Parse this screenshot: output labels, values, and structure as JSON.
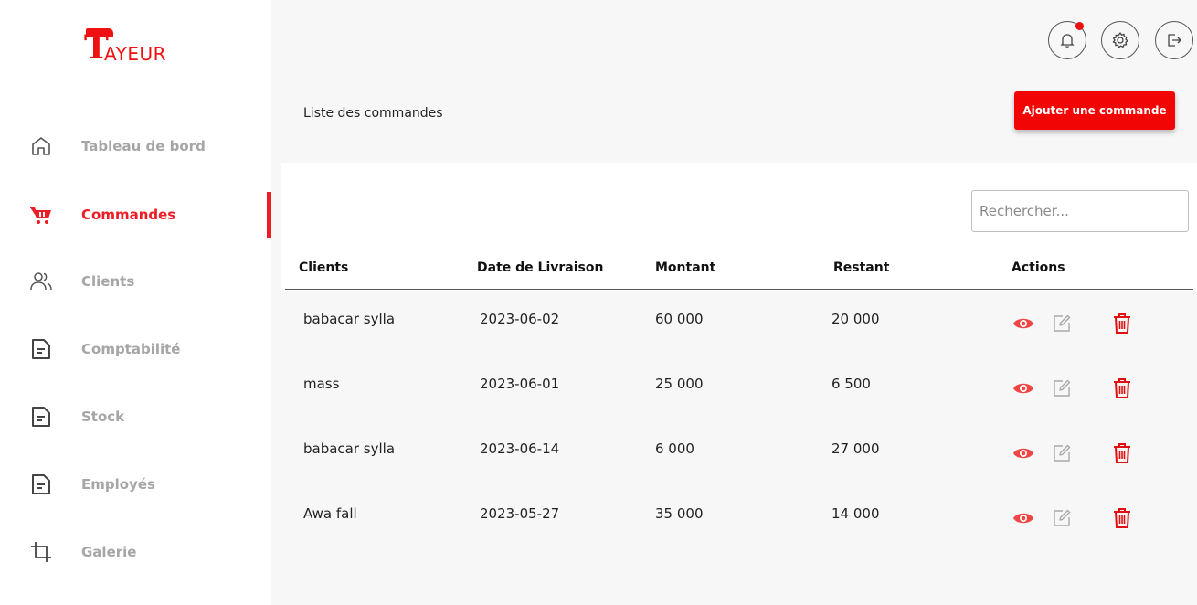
{
  "brand": {
    "logo_initial": "T",
    "logo_rest": "AYEUR",
    "accent": "#ee1c24"
  },
  "sidebar": {
    "items": [
      {
        "label": "Tableau de bord",
        "icon": "home-icon",
        "active": false
      },
      {
        "label": "Commandes",
        "icon": "cart-icon",
        "active": true
      },
      {
        "label": "Clients",
        "icon": "users-icon",
        "active": false
      },
      {
        "label": "Comptabilité",
        "icon": "document-icon",
        "active": false
      },
      {
        "label": "Stock",
        "icon": "document-icon",
        "active": false
      },
      {
        "label": "Employés",
        "icon": "document-icon",
        "active": false
      },
      {
        "label": "Galerie",
        "icon": "crop-icon",
        "active": false
      }
    ]
  },
  "topbar": {
    "icons": [
      "bell-icon",
      "gear-icon",
      "logout-icon"
    ],
    "has_notification": true
  },
  "page": {
    "title": "Liste des commandes",
    "add_button": "Ajouter une commande"
  },
  "search": {
    "placeholder": "Rechercher...",
    "value": ""
  },
  "table": {
    "columns": [
      "Clients",
      "Date de Livraison",
      "Montant",
      "Restant",
      "Actions"
    ],
    "rows": [
      {
        "client": "babacar sylla",
        "date": "2023-06-02",
        "montant": "60 000",
        "restant": "20 000"
      },
      {
        "client": "mass",
        "date": "2023-06-01",
        "montant": "25 000",
        "restant": "6 500"
      },
      {
        "client": "babacar sylla",
        "date": "2023-06-14",
        "montant": "6 000",
        "restant": "27 000"
      },
      {
        "client": "Awa fall",
        "date": "2023-05-27",
        "montant": "35 000",
        "restant": "14 000"
      }
    ],
    "actions": [
      "eye-icon",
      "edit-icon",
      "trash-icon"
    ]
  }
}
